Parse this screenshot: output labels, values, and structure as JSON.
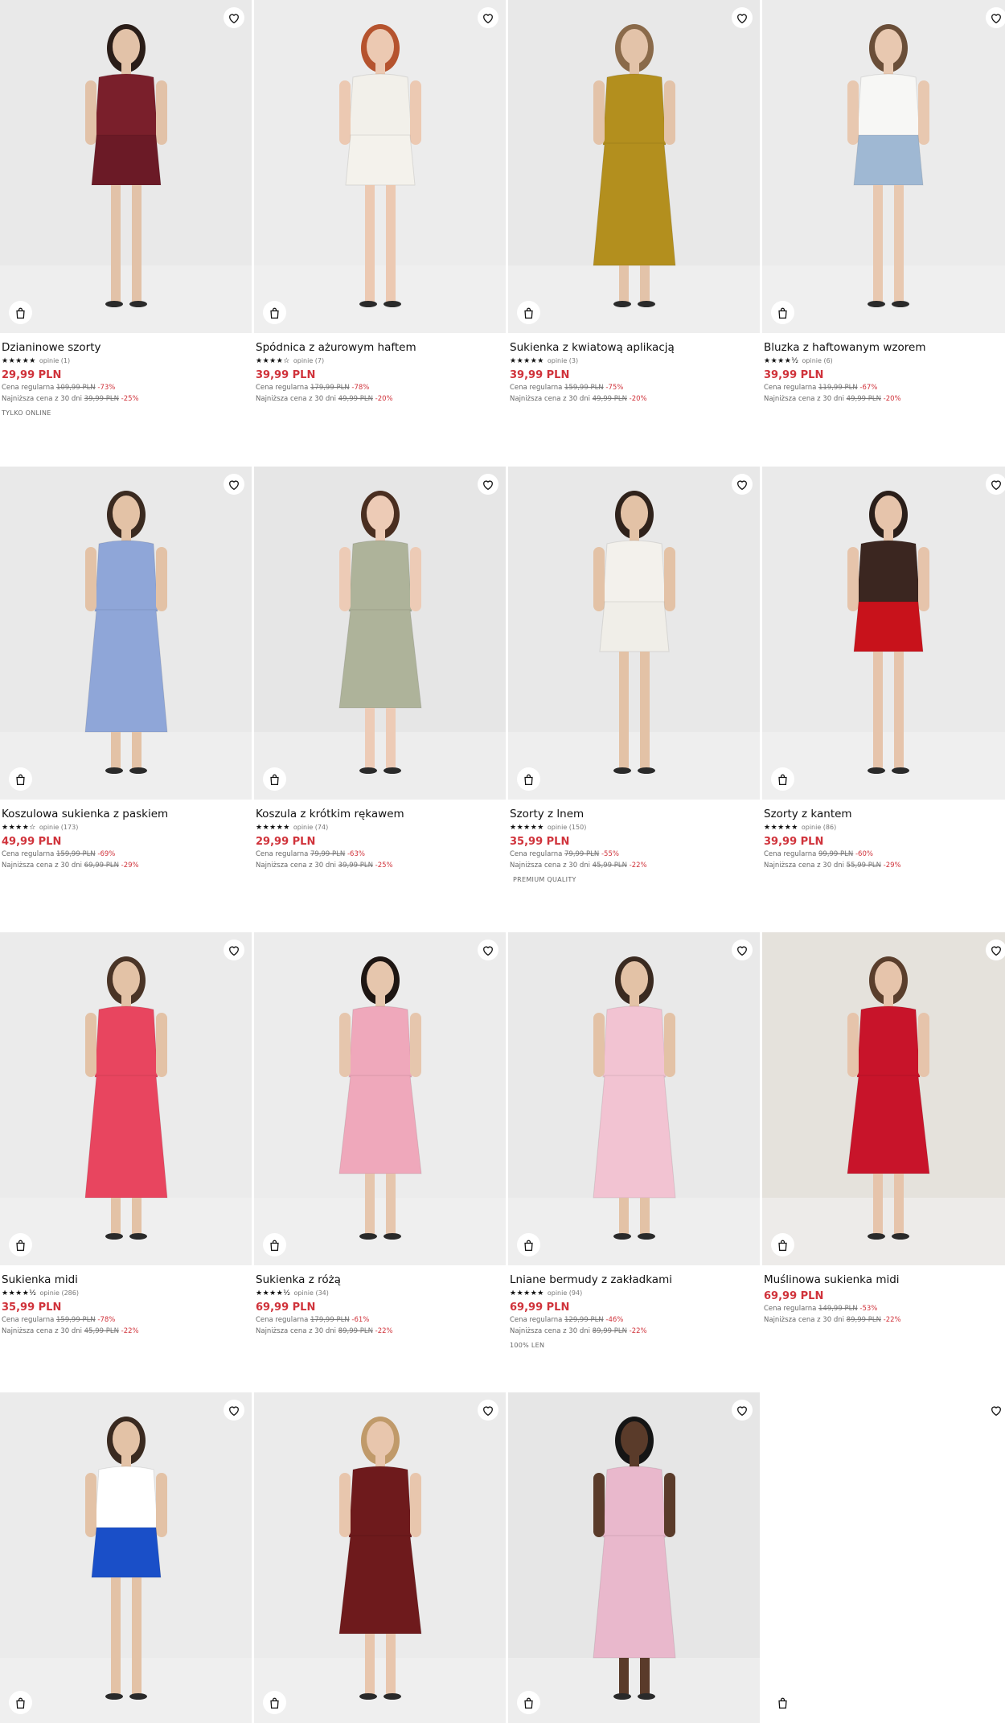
{
  "products": [
    {
      "name": "Dzianinowe szorty",
      "stars": "★★★★★",
      "reviews": "opinie (1)",
      "price": "29,99 PLN",
      "regular_label": "Cena regularna",
      "regular_old": "109,99 PLN",
      "regular_pct": "-73%",
      "lowest_label": "Najniższa cena z 30 dni",
      "lowest_old": "39,99 PLN",
      "lowest_pct": "-25%",
      "badge": "TYLKO ONLINE",
      "colors": {
        "bg": "#e9e9e9",
        "top": "#7a1f2b",
        "bottom": "#6b1a26",
        "skin": "#e2c2a8",
        "hair": "#2a1d18"
      }
    },
    {
      "name": "Spódnica z ażurowym haftem",
      "stars": "★★★★☆",
      "reviews": "opinie (7)",
      "price": "39,99 PLN",
      "regular_label": "Cena regularna",
      "regular_old": "179,99 PLN",
      "regular_pct": "-78%",
      "lowest_label": "Najniższa cena z 30 dni",
      "lowest_old": "49,99 PLN",
      "lowest_pct": "-20%",
      "badge": "",
      "colors": {
        "bg": "#ececec",
        "top": "#f2f0ea",
        "bottom": "#f4f2ec",
        "skin": "#ecc9b2",
        "hair": "#b5532e"
      }
    },
    {
      "name": "Sukienka z kwiatową aplikacją",
      "stars": "★★★★★",
      "reviews": "opinie (3)",
      "price": "39,99 PLN",
      "regular_label": "Cena regularna",
      "regular_old": "159,99 PLN",
      "regular_pct": "-75%",
      "lowest_label": "Najniższa cena z 30 dni",
      "lowest_old": "49,99 PLN",
      "lowest_pct": "-20%",
      "badge": "",
      "colors": {
        "bg": "#e8e8e8",
        "top": "#b38f1e",
        "bottom": "#b38f1e",
        "skin": "#e3c3a9",
        "hair": "#8a6a4a"
      }
    },
    {
      "name": "Bluzka z haftowanym wzorem",
      "stars": "★★★★½",
      "reviews": "opinie (6)",
      "price": "39,99 PLN",
      "regular_label": "Cena regularna",
      "regular_old": "119,99 PLN",
      "regular_pct": "-67%",
      "lowest_label": "Najniższa cena z 30 dni",
      "lowest_old": "49,99 PLN",
      "lowest_pct": "-20%",
      "badge": "",
      "colors": {
        "bg": "#ebebeb",
        "top": "#f7f7f5",
        "bottom": "#9fb8d3",
        "skin": "#e8c8b0",
        "hair": "#6a4e38"
      }
    },
    {
      "name": "Koszulowa sukienka z paskiem",
      "stars": "★★★★☆",
      "reviews": "opinie (173)",
      "price": "49,99 PLN",
      "regular_label": "Cena regularna",
      "regular_old": "159,99 PLN",
      "regular_pct": "-69%",
      "lowest_label": "Najniższa cena z 30 dni",
      "lowest_old": "69,99 PLN",
      "lowest_pct": "-29%",
      "badge": "",
      "colors": {
        "bg": "#e9e9e9",
        "top": "#8fa6d8",
        "bottom": "#8fa6d8",
        "skin": "#e3c2a6",
        "hair": "#3a2a20"
      }
    },
    {
      "name": "Koszula z krótkim rękawem",
      "stars": "★★★★★",
      "reviews": "opinie (74)",
      "price": "29,99 PLN",
      "regular_label": "Cena regularna",
      "regular_old": "79,99 PLN",
      "regular_pct": "-63%",
      "lowest_label": "Najniższa cena z 30 dni",
      "lowest_old": "39,99 PLN",
      "lowest_pct": "-25%",
      "badge": "",
      "colors": {
        "bg": "#e6e6e6",
        "top": "#aeb39a",
        "bottom": "#aeb39a",
        "skin": "#edcbb6",
        "hair": "#4a2e20"
      }
    },
    {
      "name": "Szorty z lnem",
      "stars": "★★★★★",
      "reviews": "opinie (150)",
      "price": "35,99 PLN",
      "regular_label": "Cena regularna",
      "regular_old": "79,99 PLN",
      "regular_pct": "-55%",
      "lowest_label": "Najniższa cena z 30 dni",
      "lowest_old": "45,99 PLN",
      "lowest_pct": "-22%",
      "badge": "PREMIUM QUALITY",
      "colors": {
        "bg": "#e8e8e8",
        "top": "#f3f1ec",
        "bottom": "#f0eee8",
        "skin": "#e3c2a6",
        "hair": "#2f221b"
      }
    },
    {
      "name": "Szorty z kantem",
      "stars": "★★★★★",
      "reviews": "opinie (86)",
      "price": "39,99 PLN",
      "regular_label": "Cena regularna",
      "regular_old": "99,99 PLN",
      "regular_pct": "-60%",
      "lowest_label": "Najniższa cena z 30 dni",
      "lowest_old": "55,99 PLN",
      "lowest_pct": "-29%",
      "badge": "",
      "colors": {
        "bg": "#eaeaea",
        "top": "#3b2620",
        "bottom": "#c8121b",
        "skin": "#e6c4ab",
        "hair": "#2a1e19"
      }
    },
    {
      "name": "Sukienka midi",
      "stars": "★★★★½",
      "reviews": "opinie (286)",
      "price": "35,99 PLN",
      "regular_label": "Cena regularna",
      "regular_old": "159,99 PLN",
      "regular_pct": "-78%",
      "lowest_label": "Najniższa cena z 30 dni",
      "lowest_old": "45,99 PLN",
      "lowest_pct": "-22%",
      "badge": "",
      "colors": {
        "bg": "#ebebeb",
        "top": "#e8455f",
        "bottom": "#e8455f",
        "skin": "#e3c2a6",
        "hair": "#4a3426"
      }
    },
    {
      "name": "Sukienka z różą",
      "stars": "★★★★½",
      "reviews": "opinie (34)",
      "price": "69,99 PLN",
      "regular_label": "Cena regularna",
      "regular_old": "179,99 PLN",
      "regular_pct": "-61%",
      "lowest_label": "Najniższa cena z 30 dni",
      "lowest_old": "89,99 PLN",
      "lowest_pct": "-22%",
      "badge": "",
      "colors": {
        "bg": "#ececec",
        "top": "#efa8bb",
        "bottom": "#efa8bb",
        "skin": "#e6c6ad",
        "hair": "#1e1613"
      }
    },
    {
      "name": "Lniane bermudy z zakładkami",
      "stars": "★★★★★",
      "reviews": "opinie (94)",
      "price": "69,99 PLN",
      "regular_label": "Cena regularna",
      "regular_old": "129,99 PLN",
      "regular_pct": "-46%",
      "lowest_label": "Najniższa cena z 30 dni",
      "lowest_old": "89,99 PLN",
      "lowest_pct": "-22%",
      "badge": "100% LEN",
      "colors": {
        "bg": "#e9e9e9",
        "top": "#f2c3d2",
        "bottom": "#f2c3d2",
        "skin": "#e3c2a6",
        "hair": "#3a2a20"
      }
    },
    {
      "name": "Muślinowa sukienka midi",
      "stars": "",
      "reviews": "",
      "price": "69,99 PLN",
      "regular_label": "Cena regularna",
      "regular_old": "149,99 PLN",
      "regular_pct": "-53%",
      "lowest_label": "Najniższa cena z 30 dni",
      "lowest_old": "89,99 PLN",
      "lowest_pct": "-22%",
      "badge": "",
      "colors": {
        "bg": "#e5e2dc",
        "top": "#c8142a",
        "bottom": "#c8142a",
        "skin": "#e6c4ab",
        "hair": "#5a3e2c"
      }
    },
    {
      "name": "",
      "stars": "",
      "reviews": "",
      "price": "",
      "regular_label": "",
      "regular_old": "",
      "regular_pct": "",
      "lowest_label": "",
      "lowest_old": "",
      "lowest_pct": "",
      "badge": "",
      "colors": {
        "bg": "#ebebeb",
        "top": "#ffffff",
        "bottom": "#1a4fc8",
        "skin": "#e3c2a6",
        "hair": "#3a2a20"
      }
    },
    {
      "name": "",
      "stars": "",
      "reviews": "",
      "price": "",
      "regular_label": "",
      "regular_old": "",
      "regular_pct": "",
      "lowest_label": "",
      "lowest_old": "",
      "lowest_pct": "",
      "badge": "",
      "colors": {
        "bg": "#ebebeb",
        "top": "#6e1a1c",
        "bottom": "#6e1a1c",
        "skin": "#e8c6ad",
        "hair": "#c09a6a"
      }
    },
    {
      "name": "",
      "stars": "",
      "reviews": "",
      "price": "",
      "regular_label": "",
      "regular_old": "",
      "regular_pct": "",
      "lowest_label": "",
      "lowest_old": "",
      "lowest_pct": "",
      "badge": "",
      "colors": {
        "bg": "#e6e6e6",
        "top": "#e9b8cc",
        "bottom": "#e9b8cc",
        "skin": "#5a3b2a",
        "hair": "#151515"
      }
    },
    {
      "name": "",
      "stars": "",
      "reviews": "",
      "price": "",
      "regular_label": "",
      "regular_old": "",
      "regular_pct": "",
      "lowest_label": "",
      "lowest_old": "",
      "lowest_pct": "",
      "badge": "",
      "colors": {
        "bg": "#ffffff",
        "top": "#ffffff",
        "bottom": "#ffffff",
        "skin": "#ffffff",
        "hair": "#ffffff"
      },
      "empty": true
    }
  ],
  "accent_price_color": "#d0333b",
  "icons": {
    "favorite": "heart-outline-icon",
    "add_to_cart": "shopping-bag-icon"
  }
}
